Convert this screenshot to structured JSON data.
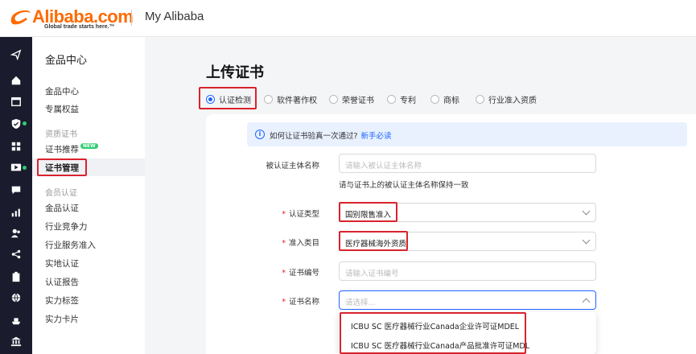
{
  "header": {
    "brand": "Alibaba.com",
    "tagline": "Global trade starts here.™",
    "app_title": "My Alibaba"
  },
  "rail": {
    "icons": [
      "send-icon",
      "home-icon",
      "store-icon",
      "shield-icon",
      "grid-icon",
      "video-icon",
      "chat-icon",
      "chart-icon",
      "people-icon",
      "share-icon",
      "clipboard-icon",
      "globe-icon",
      "ship-icon",
      "bank-icon"
    ]
  },
  "subnav": {
    "title": "金品中心",
    "items": [
      {
        "label": "金品中心"
      },
      {
        "label": "专属权益"
      }
    ],
    "group_cert": "资质证书",
    "cert_items": [
      {
        "label": "证书推荐",
        "badge": "NEW"
      },
      {
        "label": "证书管理"
      }
    ],
    "group_member": "会员认证",
    "member_items": [
      {
        "label": "金品认证"
      },
      {
        "label": "行业竞争力"
      },
      {
        "label": "行业服务准入"
      },
      {
        "label": "实地认证"
      },
      {
        "label": "认证报告"
      },
      {
        "label": "实力标签"
      },
      {
        "label": "实力卡片"
      }
    ]
  },
  "main": {
    "title": "上传证书",
    "radios": [
      {
        "label": "认证检测",
        "checked": true
      },
      {
        "label": "软件著作权"
      },
      {
        "label": "荣誉证书"
      },
      {
        "label": "专利"
      },
      {
        "label": "商标"
      },
      {
        "label": "行业准入资质"
      }
    ],
    "info": {
      "text": "如何让证书验真一次通过?",
      "link": "新手必读"
    },
    "form": {
      "subject_label": "被认证主体名称",
      "subject_placeholder": "请输入被认证主体名称",
      "subject_hint": "请与证书上的被认证主体名称保持一致",
      "type_label": "认证类型",
      "type_value": "国别限售准入",
      "category_label": "准入类目",
      "category_value": "医疗器械海外资质",
      "number_label": "证书编号",
      "number_placeholder": "请输入证书编号",
      "name_label": "证书名称",
      "name_placeholder": "请选择...",
      "required_mark": "*"
    },
    "dropdown_options": [
      "ICBU SC 医疗器械行业Canada企业许可证MDEL",
      "ICBU SC 医疗器械行业Canada产品批准许可证MDL"
    ]
  },
  "colors": {
    "accent": "#1e66ff",
    "brand": "#ff6a00",
    "highlight": "#d9232d",
    "rail_bg": "#1a1c2e"
  }
}
